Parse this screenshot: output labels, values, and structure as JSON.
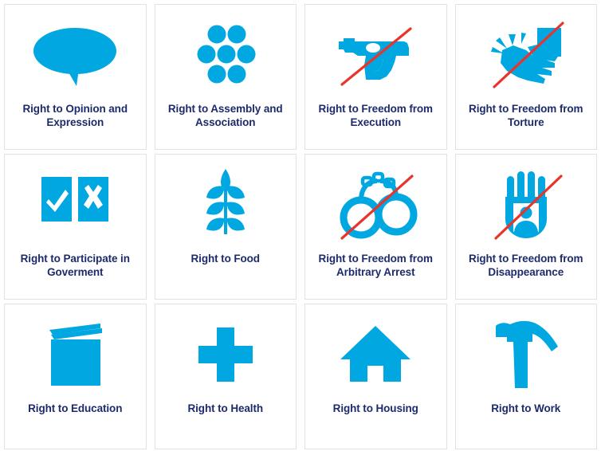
{
  "page": {
    "title": "Human Rights Icon Grid",
    "columns": 4,
    "rows": 3
  },
  "colors": {
    "icon_blue": "#00a7e1",
    "strike_red": "#e8342a",
    "label_navy": "#1d2b6b",
    "card_border": "#e2e2e2",
    "background": "#ffffff"
  },
  "cards": [
    {
      "id": "opinion-expression",
      "label": "Right to Opinion and Expression",
      "icon": "speech-bubble-icon",
      "struck_through": false
    },
    {
      "id": "assembly-association",
      "label": "Right to Assembly and Association",
      "icon": "group-of-dots-icon",
      "struck_through": false
    },
    {
      "id": "freedom-from-execution",
      "label": "Right to Freedom from Execution",
      "icon": "handgun-icon",
      "struck_through": true
    },
    {
      "id": "freedom-from-torture",
      "label": "Right to Freedom from Torture",
      "icon": "hand-striking-hand-icon",
      "struck_through": true
    },
    {
      "id": "participate-in-government",
      "label": "Right to Participate in Goverment",
      "icon": "ballot-check-and-cross-icon",
      "struck_through": false
    },
    {
      "id": "food",
      "label": "Right to Food",
      "icon": "wheat-stalk-icon",
      "struck_through": false
    },
    {
      "id": "freedom-from-arbitrary-arrest",
      "label": "Right to Freedom from Arbitrary Arrest",
      "icon": "handcuffs-icon",
      "struck_through": true
    },
    {
      "id": "freedom-from-disappearance",
      "label": "Right to Freedom from Disappearance",
      "icon": "hand-with-person-icon",
      "struck_through": true
    },
    {
      "id": "education",
      "label": "Right to Education",
      "icon": "book-icon",
      "struck_through": false
    },
    {
      "id": "health",
      "label": "Right to Health",
      "icon": "medical-cross-icon",
      "struck_through": false
    },
    {
      "id": "housing",
      "label": "Right to Housing",
      "icon": "house-icon",
      "struck_through": false
    },
    {
      "id": "work",
      "label": "Right to Work",
      "icon": "hammer-icon",
      "struck_through": false
    }
  ]
}
